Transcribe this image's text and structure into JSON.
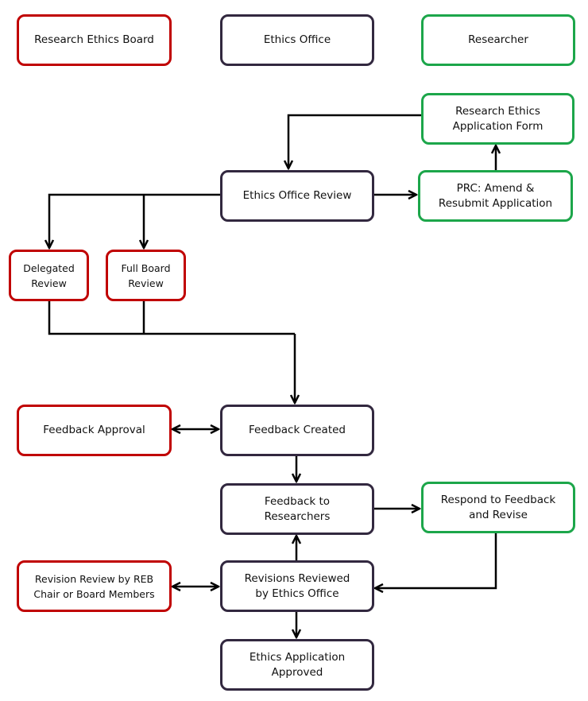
{
  "colors": {
    "reb": "#c00000",
    "ethics_office": "#32283f",
    "researcher": "#1ca64a",
    "connector": "#000000"
  },
  "legend": {
    "reb": "Research Ethics Board",
    "ethics_office": "Ethics Office",
    "researcher": "Researcher"
  },
  "nodes": {
    "application_form": "Research Ethics Application Form",
    "ethics_office_review": "Ethics Office Review",
    "prc": "PRC: Amend & Resubmit Application",
    "delegated_review": "Delegated Review",
    "full_board_review": "Full Board Review",
    "feedback_approval": "Feedback Approval",
    "feedback_created": "Feedback Created",
    "feedback_to_researchers": "Feedback to Researchers",
    "respond_to_feedback": "Respond to Feedback and Revise",
    "revision_review_reb": "Revision Review by REB Chair or Board Members",
    "revisions_reviewed": "Revisions Reviewed by Ethics Office",
    "approved": "Ethics Application Approved"
  }
}
